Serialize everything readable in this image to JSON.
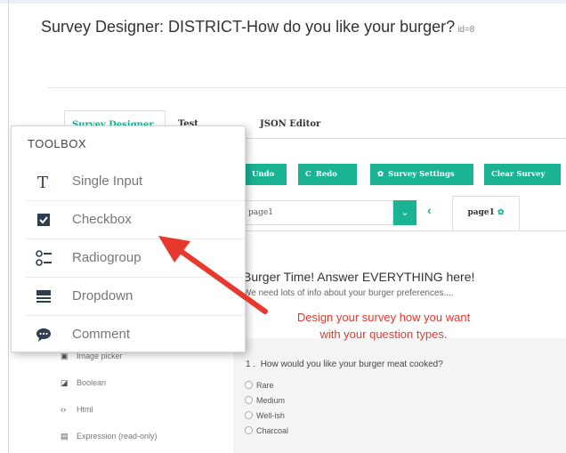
{
  "page": {
    "title": "Survey Designer: DISTRICT-How do you like your burger?",
    "id_text": "id=8"
  },
  "tabs": [
    {
      "label": "Survey Designer"
    },
    {
      "label": "Test Survey"
    },
    {
      "label": "JSON Editor"
    }
  ],
  "toolbar": {
    "undo": "Undo",
    "redo": "Redo",
    "settings": "Survey Settings",
    "clear": "Clear Survey"
  },
  "page_nav": {
    "select_value": "page1",
    "tab_label": "page1"
  },
  "survey": {
    "title": "Burger Time! Answer EVERYTHING here!",
    "description": "We need lots of info about your burger preferences....",
    "question": {
      "number": "1 .",
      "title": "How would you like your burger meat cooked?",
      "choices": [
        "Rare",
        "Medium",
        "Well-ish",
        "Charcoal"
      ]
    }
  },
  "left_list": [
    {
      "label": "Image picker",
      "icon": "image-icon"
    },
    {
      "label": "Boolean",
      "icon": "boolean-icon"
    },
    {
      "label": "Html",
      "icon": "code-icon"
    },
    {
      "label": "Expression (read-only)",
      "icon": "expression-icon"
    }
  ],
  "toolbox": {
    "title": "TOOLBOX",
    "items": [
      {
        "label": "Single Input",
        "icon": "text-icon"
      },
      {
        "label": "Checkbox",
        "icon": "checkbox-icon"
      },
      {
        "label": "Radiogroup",
        "icon": "radiogroup-icon"
      },
      {
        "label": "Dropdown",
        "icon": "dropdown-icon"
      },
      {
        "label": "Comment",
        "icon": "comment-icon"
      }
    ]
  },
  "annotation": {
    "line1": "Design your survey how you want",
    "line2": "with your question types."
  },
  "colors": {
    "accent": "#1ab394",
    "annotation": "#e8372d",
    "icon_dark": "#2e3d52"
  }
}
